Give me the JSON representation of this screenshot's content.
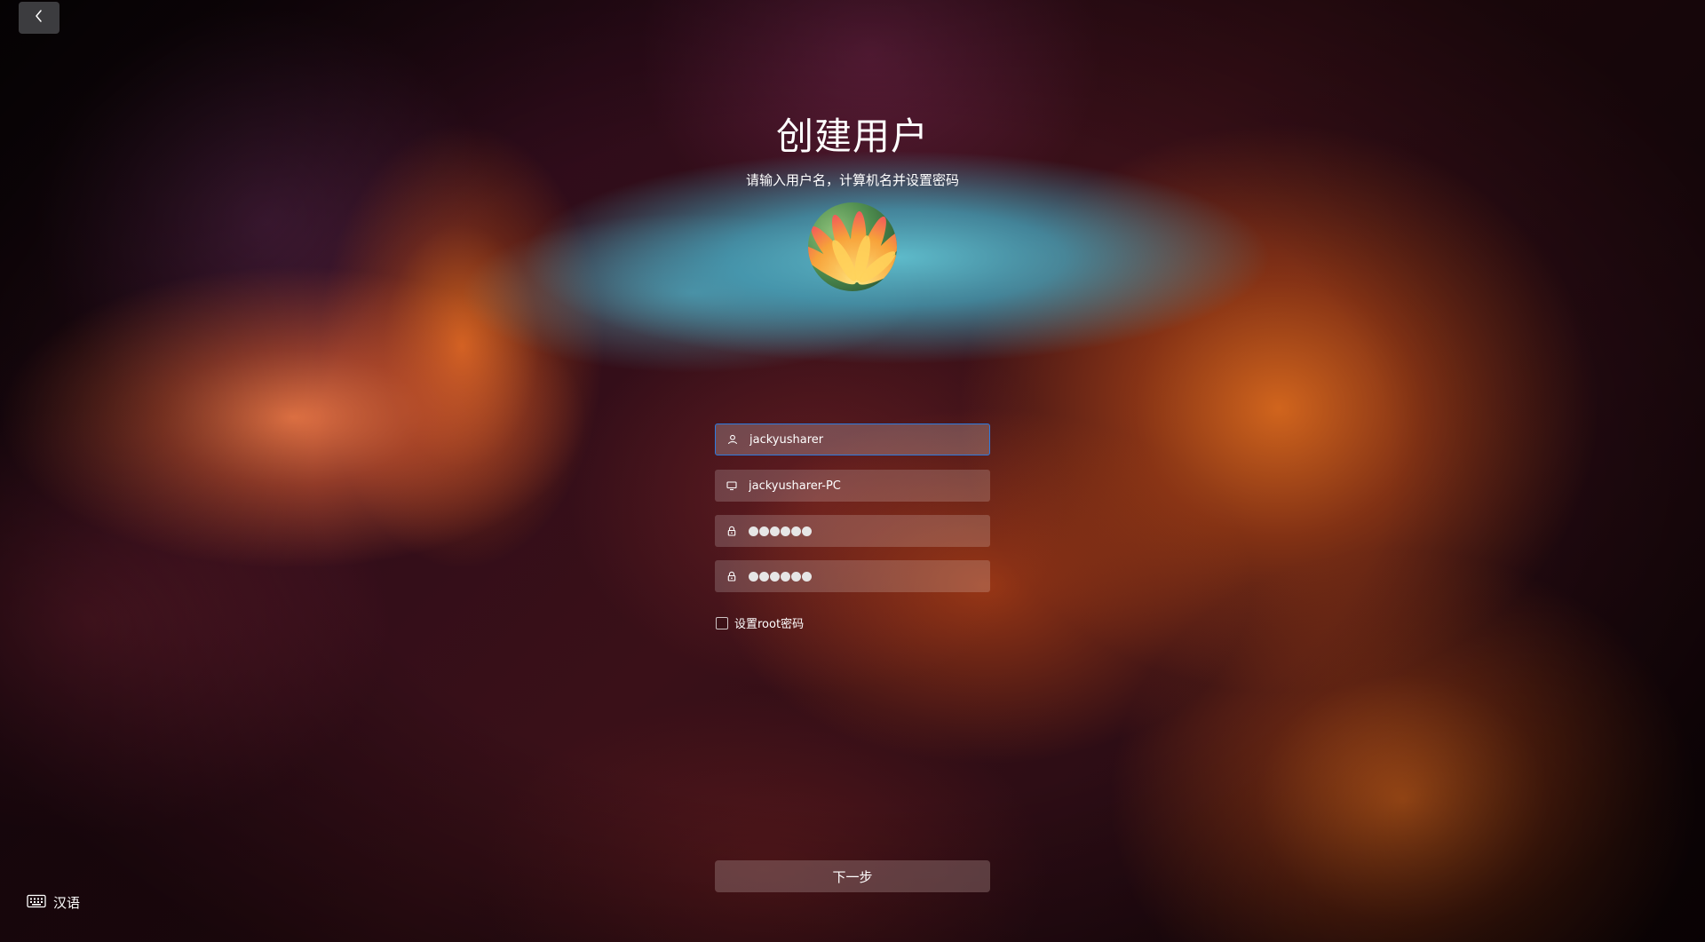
{
  "header": {
    "title": "创建用户",
    "subtitle": "请输入用户名，计算机名并设置密码"
  },
  "form": {
    "username": {
      "value": "jackyusharer",
      "icon": "user-icon"
    },
    "computer_name": {
      "value": "jackyusharer-PC",
      "icon": "computer-icon"
    },
    "password": {
      "icon": "lock-icon",
      "masked_length": 6
    },
    "confirm_password": {
      "icon": "lock-icon",
      "masked_length": 6
    },
    "root_password_label": "设置root密码",
    "root_password_checked": false
  },
  "actions": {
    "next_label": "下一步"
  },
  "footer": {
    "language_label": "汉语",
    "language_icon": "keyboard-icon"
  },
  "colors": {
    "focus_border": "#2d7be0"
  }
}
